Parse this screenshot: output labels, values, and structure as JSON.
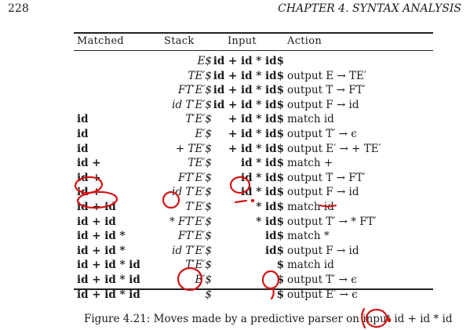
{
  "header": {
    "page_number": "228",
    "running_head": "CHAPTER 4.  SYNTAX ANALYSIS"
  },
  "table": {
    "columns": [
      "Matched",
      "Stack",
      "Input",
      "Action"
    ],
    "rows": [
      {
        "matched": "",
        "stack": "E$",
        "input": "id + id * id$",
        "action": ""
      },
      {
        "matched": "",
        "stack": "TE′$",
        "input": "id + id * id$",
        "action": "output E → TE′"
      },
      {
        "matched": "",
        "stack": "FT′E′$",
        "input": "id + id * id$",
        "action": "output T → FT′"
      },
      {
        "matched": "",
        "stack": "id T′E′$",
        "input": "id + id * id$",
        "action": "output F → id"
      },
      {
        "matched": "id",
        "stack": "T′E′$",
        "input": "+ id * id$",
        "action": "match id"
      },
      {
        "matched": "id",
        "stack": "E′$",
        "input": "+ id * id$",
        "action": "output T′ → ϵ"
      },
      {
        "matched": "id",
        "stack": "+ TE′$",
        "input": "+ id * id$",
        "action": "output E′ → + TE′"
      },
      {
        "matched": "id +",
        "stack": "TE′$",
        "input": "id * id$",
        "action": "match +"
      },
      {
        "matched": "id +",
        "stack": "FT′E′$",
        "input": "id * id$",
        "action": "output T → FT′"
      },
      {
        "matched": "id +",
        "stack": "id T′E′$",
        "input": "id * id$",
        "action": "output F → id"
      },
      {
        "matched": "id + id",
        "stack": "T′E′$",
        "input": "* id$",
        "action": "match id"
      },
      {
        "matched": "id + id",
        "stack": "* FT′E′$",
        "input": "* id$",
        "action": "output T′ → * FT′"
      },
      {
        "matched": "id + id *",
        "stack": "FT′E′$",
        "input": "id$",
        "action": "match *"
      },
      {
        "matched": "id + id *",
        "stack": "id T′E′$",
        "input": "id$",
        "action": "output F → id"
      },
      {
        "matched": "id + id * id",
        "stack": "T′E′$",
        "input": "$",
        "action": "match id"
      },
      {
        "matched": "id + id * id",
        "stack": "E′$",
        "input": "$",
        "action": "output T′ → ϵ"
      },
      {
        "matched": "id + id * id",
        "stack": "$",
        "input": "$",
        "action": "output E′ → ϵ"
      }
    ]
  },
  "caption": "Figure 4.21: Moves made by a predictive parser on input id + id * id",
  "annotation_color": "#d41414"
}
